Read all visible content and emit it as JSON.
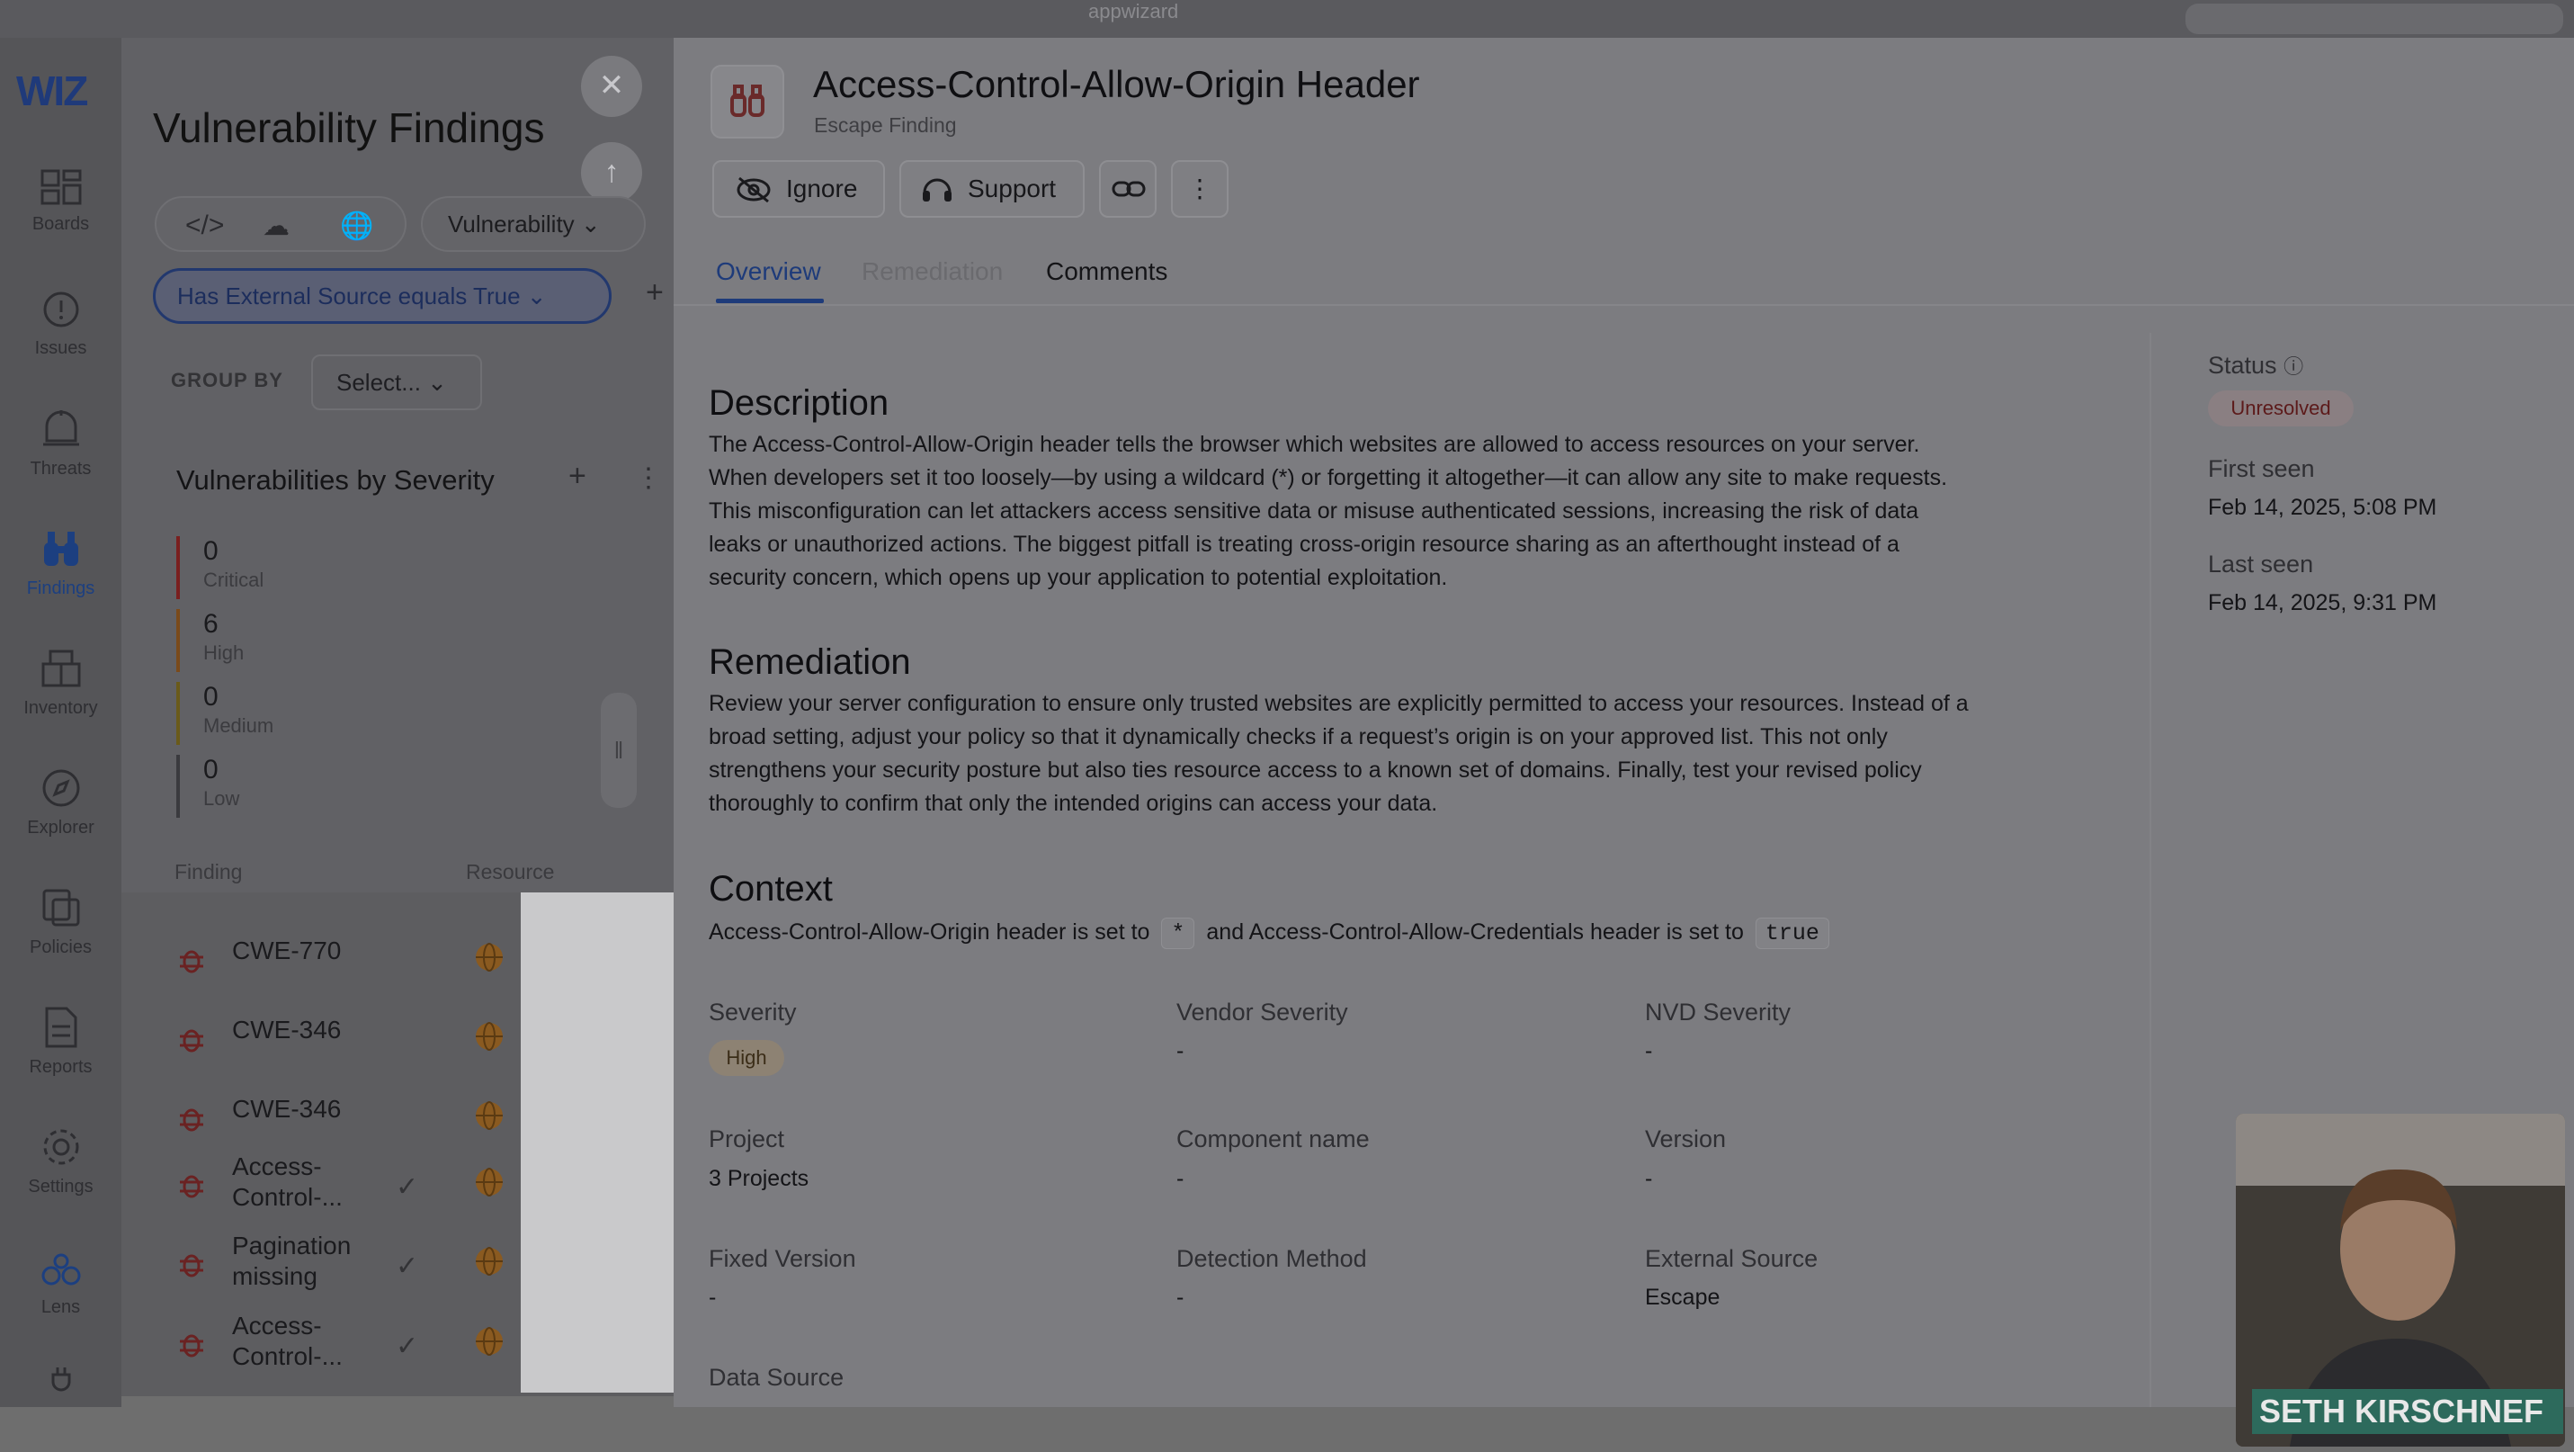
{
  "browser": {
    "app_name": "appwizard"
  },
  "nav": {
    "logo": "WIZ",
    "items": [
      {
        "label": "Boards",
        "icon": "boards-icon"
      },
      {
        "label": "Issues",
        "icon": "issues-icon"
      },
      {
        "label": "Threats",
        "icon": "threats-icon"
      },
      {
        "label": "Findings",
        "icon": "binoculars-icon",
        "active": true
      },
      {
        "label": "Inventory",
        "icon": "inventory-icon"
      },
      {
        "label": "Explorer",
        "icon": "explorer-icon"
      },
      {
        "label": "Policies",
        "icon": "policies-icon"
      },
      {
        "label": "Reports",
        "icon": "reports-icon"
      },
      {
        "label": "Settings",
        "icon": "gear-icon"
      },
      {
        "label": "Lens",
        "icon": "lens-icon"
      }
    ]
  },
  "findings_panel": {
    "title": "Vulnerability Findings",
    "type_dropdown": "Vulnerability",
    "filter_chip": "Has External Source equals True",
    "group_by_label": "GROUP BY",
    "group_by_value": "Select...",
    "severity_widget_title": "Vulnerabilities by Severity",
    "severity_counts": [
      {
        "count": "0",
        "label": "Critical",
        "color": "#7a1f1f"
      },
      {
        "count": "6",
        "label": "High",
        "color": "#7a4a1a"
      },
      {
        "count": "0",
        "label": "Medium",
        "color": "#6a5a1a"
      },
      {
        "count": "0",
        "label": "Low",
        "color": "#3a3a3e"
      }
    ],
    "columns": {
      "finding": "Finding",
      "resource": "Resource"
    },
    "rows": [
      {
        "name": "CWE-770",
        "checked": false
      },
      {
        "name": "CWE-346",
        "checked": false
      },
      {
        "name": "CWE-346",
        "checked": false
      },
      {
        "name": "Access-\nControl-...",
        "line1": "Access-",
        "line2": "Control-...",
        "checked": true
      },
      {
        "name": "Pagination missing",
        "line1": "Pagination",
        "line2": "missing",
        "checked": true
      },
      {
        "name": "Access-\nControl-...",
        "line1": "Access-",
        "line2": "Control-...",
        "checked": true
      }
    ]
  },
  "detail": {
    "title": "Access-Control-Allow-Origin Header",
    "subtitle": "Escape Finding",
    "toolbar": {
      "ignore": "Ignore",
      "support": "Support"
    },
    "tabs": [
      "Overview",
      "Remediation",
      "Comments"
    ],
    "description_heading": "Description",
    "description_lines": [
      "The Access-Control-Allow-Origin header tells the browser which websites are allowed to access resources on your server.",
      "When developers set it too loosely—by using a wildcard (*) or forgetting it altogether—it can allow any site to make requests.",
      "This misconfiguration can let attackers access sensitive data or misuse authenticated sessions, increasing the risk of data",
      "leaks or unauthorized actions. The biggest pitfall is treating cross-origin resource sharing as an afterthought instead of a",
      "security concern, which opens up your application to potential exploitation."
    ],
    "remediation_heading": "Remediation",
    "remediation_lines": [
      "Review your server configuration to ensure only trusted websites are explicitly permitted to access your resources. Instead of a",
      "broad setting, adjust your policy so that it dynamically checks if a request’s origin is on your approved list. This not only",
      "strengthens your security posture but also ties resource access to a known set of domains. Finally, test your revised policy",
      "thoroughly to confirm that only the intended origins can access your data."
    ],
    "context_heading": "Context",
    "context": {
      "part1": "Access-Control-Allow-Origin header is set to",
      "code1": "*",
      "part2": "and Access-Control-Allow-Credentials header is set to",
      "code2": "true"
    },
    "fields": {
      "severity_label": "Severity",
      "severity_value": "High",
      "vendor_severity_label": "Vendor Severity",
      "vendor_severity_value": "-",
      "nvd_severity_label": "NVD Severity",
      "nvd_severity_value": "-",
      "project_label": "Project",
      "project_value": "3 Projects",
      "component_label": "Component name",
      "component_value": "-",
      "version_label": "Version",
      "version_value": "-",
      "fixed_version_label": "Fixed Version",
      "fixed_version_value": "-",
      "detection_label": "Detection Method",
      "detection_value": "-",
      "external_source_label": "External Source",
      "external_source_value": "Escape",
      "data_source_label": "Data Source"
    },
    "sidebar": {
      "status_label": "Status",
      "status_value": "Unresolved",
      "first_seen_label": "First seen",
      "first_seen_value": "Feb 14, 2025, 5:08 PM",
      "last_seen_label": "Last seen",
      "last_seen_value": "Feb 14, 2025, 9:31 PM"
    }
  },
  "webcam": {
    "name": "SETH KIRSCHNEF"
  },
  "colors": {
    "accent": "#1e3b7a",
    "overlay": "#6e6e6e"
  }
}
